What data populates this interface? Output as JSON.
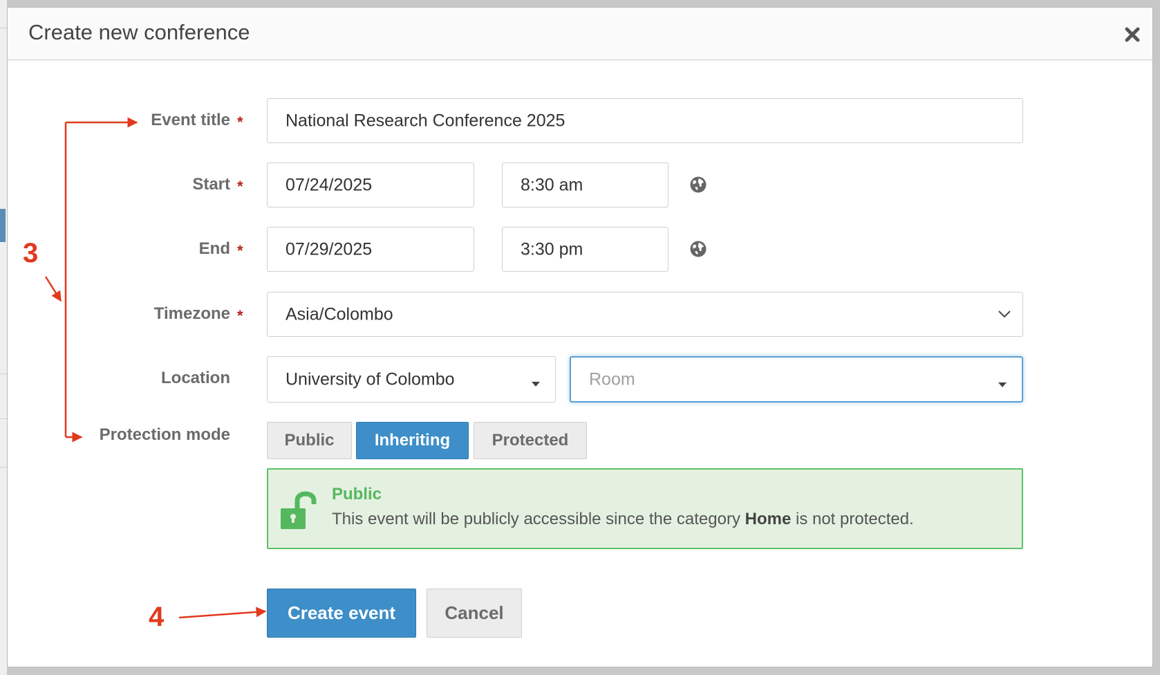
{
  "dialog": {
    "title": "Create new conference"
  },
  "form": {
    "event_title": {
      "label": "Event title",
      "required_mark": "*",
      "value": "National Research Conference 2025"
    },
    "start": {
      "label": "Start",
      "required_mark": "*",
      "date": "07/24/2025",
      "time": "8:30 am"
    },
    "end": {
      "label": "End",
      "required_mark": "*",
      "date": "07/29/2025",
      "time": "3:30 pm"
    },
    "timezone": {
      "label": "Timezone",
      "required_mark": "*",
      "value": "Asia/Colombo"
    },
    "location": {
      "label": "Location",
      "venue": "University of Colombo",
      "room_placeholder": "Room"
    },
    "protection": {
      "label": "Protection mode",
      "options": [
        "Public",
        "Inheriting",
        "Protected"
      ],
      "selected": "Inheriting"
    }
  },
  "notice": {
    "title": "Public",
    "text_before": "This event will be publicly accessible since the category ",
    "category": "Home",
    "text_after": " is not protected.",
    "color": "#5cc067"
  },
  "actions": {
    "create_label": "Create event",
    "cancel_label": "Cancel"
  },
  "annotations": {
    "step_3": "3",
    "step_4": "4",
    "color": "#e03a1e"
  },
  "icons": {
    "close": "close-icon",
    "timezone": "globe-icon",
    "notice": "unlock-icon",
    "dropdown": "chevron-down-icon"
  }
}
